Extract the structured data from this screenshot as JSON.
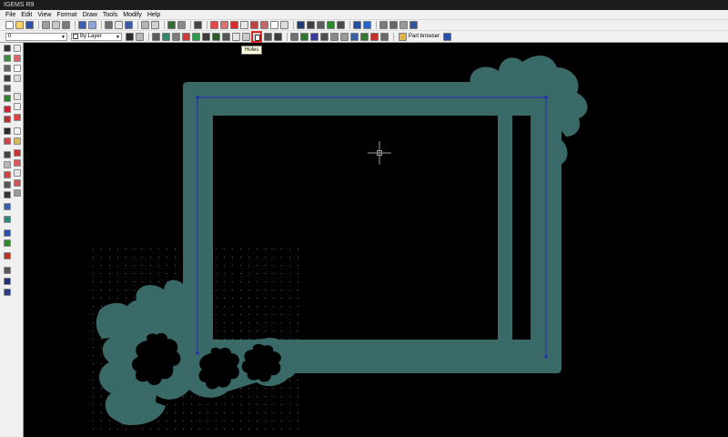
{
  "app": {
    "title": "IGEMS R9"
  },
  "menu": [
    "File",
    "Edit",
    "View",
    "Format",
    "Draw",
    "Tools",
    "Modify",
    "Help"
  ],
  "toolbar": {
    "layer_value": "0",
    "color_value": "By Layer",
    "part_browser_label": "Part browser",
    "holes_tooltip": "Holes"
  },
  "colors": {
    "shape_fill": "#3a6a68",
    "holes": "#000000",
    "outline": "#2929b8",
    "ui_bg": "#f0f0f0",
    "highlight": "#d01010"
  }
}
